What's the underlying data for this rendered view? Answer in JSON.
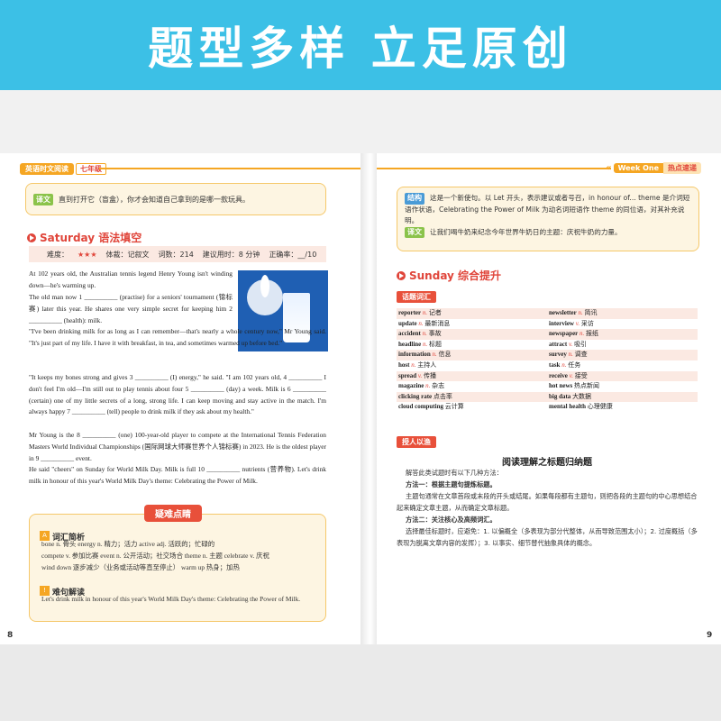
{
  "banner": {
    "title": "题型多样 立足原创"
  },
  "header_left": {
    "series": "英语时文阅读",
    "grade": "七年级"
  },
  "header_right": {
    "week": "Week One",
    "section": "热点速递"
  },
  "left_page": {
    "top_translation": {
      "tag": "译文",
      "text": "直到打开它（盲盒），你才会知道自己拿到的是哪一款玩具。"
    },
    "section_title": "Saturday 语法填空",
    "info": {
      "difficulty_label": "难度：",
      "stars": "★★★",
      "genre": "体裁：记叙文",
      "words": "词数：214",
      "time": "建议用时：8 分钟",
      "score": "正确率：__/10"
    },
    "paragraphs": [
      "At 102 years old, the Australian tennis legend Henry Young isn't winding down—he's warming up.",
      "The old man now 1 __________ (practise) for a seniors' tournament (锦标赛) later this year. He shares one very simple secret for keeping him 2 __________ (health): milk.",
      "\"I've been drinking milk for as long as I can remember—that's nearly a whole century now,\" Mr Young said. \"It's just part of my life. I have it with breakfast, in tea, and sometimes warmed up before bed.\"",
      "\"It keeps my bones strong and gives 3 __________ (I) energy,\" he said. \"I am 102 years old, 4 __________ I don't feel I'm old—I'm still out to play tennis about four 5 __________ (day) a week. Milk is 6 __________ (certain) one of my little secrets of a long, strong life. I can keep moving and stay active in the match. I'm always happy 7 __________ (tell) people to drink milk if they ask about my health.\"",
      "Mr Young is the 8 __________ (one) 100-year-old player to compete at the International Tennis Federation Masters World Individual Championships (国际网球大师赛世界个人锦标赛) in 2023. He is the oldest player in 9 __________ event.",
      "He said \"cheers\" on Sunday for World Milk Day. Milk is full 10 __________ nutrients (营养物). Let's drink milk in honour of this year's World Milk Day's theme: Celebrating the Power of Milk."
    ],
    "notes_badge": "疑难点睛",
    "vocab_title": "词汇简析",
    "vocab_lines": [
      "bone n. 骨头    energy n. 精力；活力    active adj. 活跃的；忙碌的",
      "compete v. 参加比赛    event n. 公开活动；社交场合    theme n. 主题    celebrate v. 庆祝",
      "wind down  逐步减少（业务或活动等直至停止）    warm up 热身；加热"
    ],
    "sentence_title": "难句解读",
    "sentence_text": "Let's drink milk in honour of this year's World Milk Day's theme: Celebrating the Power of Milk.",
    "page_number": "8"
  },
  "right_page": {
    "structure": {
      "tag": "结构",
      "text": "这是一个新使句。以 Let 开头，表示建议或者号召，in honour of... theme 是介词短语作状语，Celebrating the Power of Milk 为动名词短语作 theme 的同位语，对其补充说明。"
    },
    "translation": {
      "tag": "译文",
      "text": "让我们喝牛奶来纪念今年世界牛奶日的主题：庆祝牛奶的力量。"
    },
    "section_title": "Sunday 综合提升",
    "vocab_tag": "话题词汇",
    "vocab": [
      [
        "reporter",
        "n.",
        "记者",
        "newsletter",
        "n.",
        "简讯"
      ],
      [
        "update",
        "n.",
        "最新消息",
        "interview",
        "v.",
        "采访"
      ],
      [
        "accident",
        "n.",
        "事故",
        "newspaper",
        "n.",
        "报纸"
      ],
      [
        "headline",
        "n.",
        "标题",
        "attract",
        "v.",
        "吸引"
      ],
      [
        "information",
        "n.",
        "信息",
        "survey",
        "n.",
        "调查"
      ],
      [
        "host",
        "n.",
        "主持人",
        "task",
        "n.",
        "任务"
      ],
      [
        "spread",
        "v.",
        "传播",
        "receive",
        "v.",
        "接受"
      ],
      [
        "magazine",
        "n.",
        "杂志",
        "hot news",
        "",
        "热点新闻"
      ],
      [
        "clicking rate",
        "",
        "点击率",
        "big data",
        "",
        "大数据"
      ],
      [
        "cloud computing",
        "",
        "云计算",
        "mental health",
        "",
        "心理健康"
      ]
    ],
    "skill_tag": "授人以渔",
    "skill_title": "阅读理解之标题归纳题",
    "skill_lines": [
      "解答此类试题时有以下几种方法：",
      "方法一：根据主题句提炼标题。",
      "主题句通常在文章首段或末段的开头或结尾。如果每段都有主题句，则把各段的主题句的中心思想结合起来确定文章主题，从而确定文章标题。",
      "方法二：关注核心及高频词汇。",
      "选择最佳标题时，应避免：1. 以偏概全（多表现为部分代整体，从而导致范围太小）；2. 过度概括（多表现为脱离文章内容的发挥）；3. 以事实、细节替代抽象具体的概念。"
    ],
    "page_number": "9"
  },
  "colors": {
    "banner": "#3cc0e6",
    "accent_orange": "#f5a623",
    "accent_red": "#e0453a",
    "callout_bg": "#fdf5e2"
  }
}
